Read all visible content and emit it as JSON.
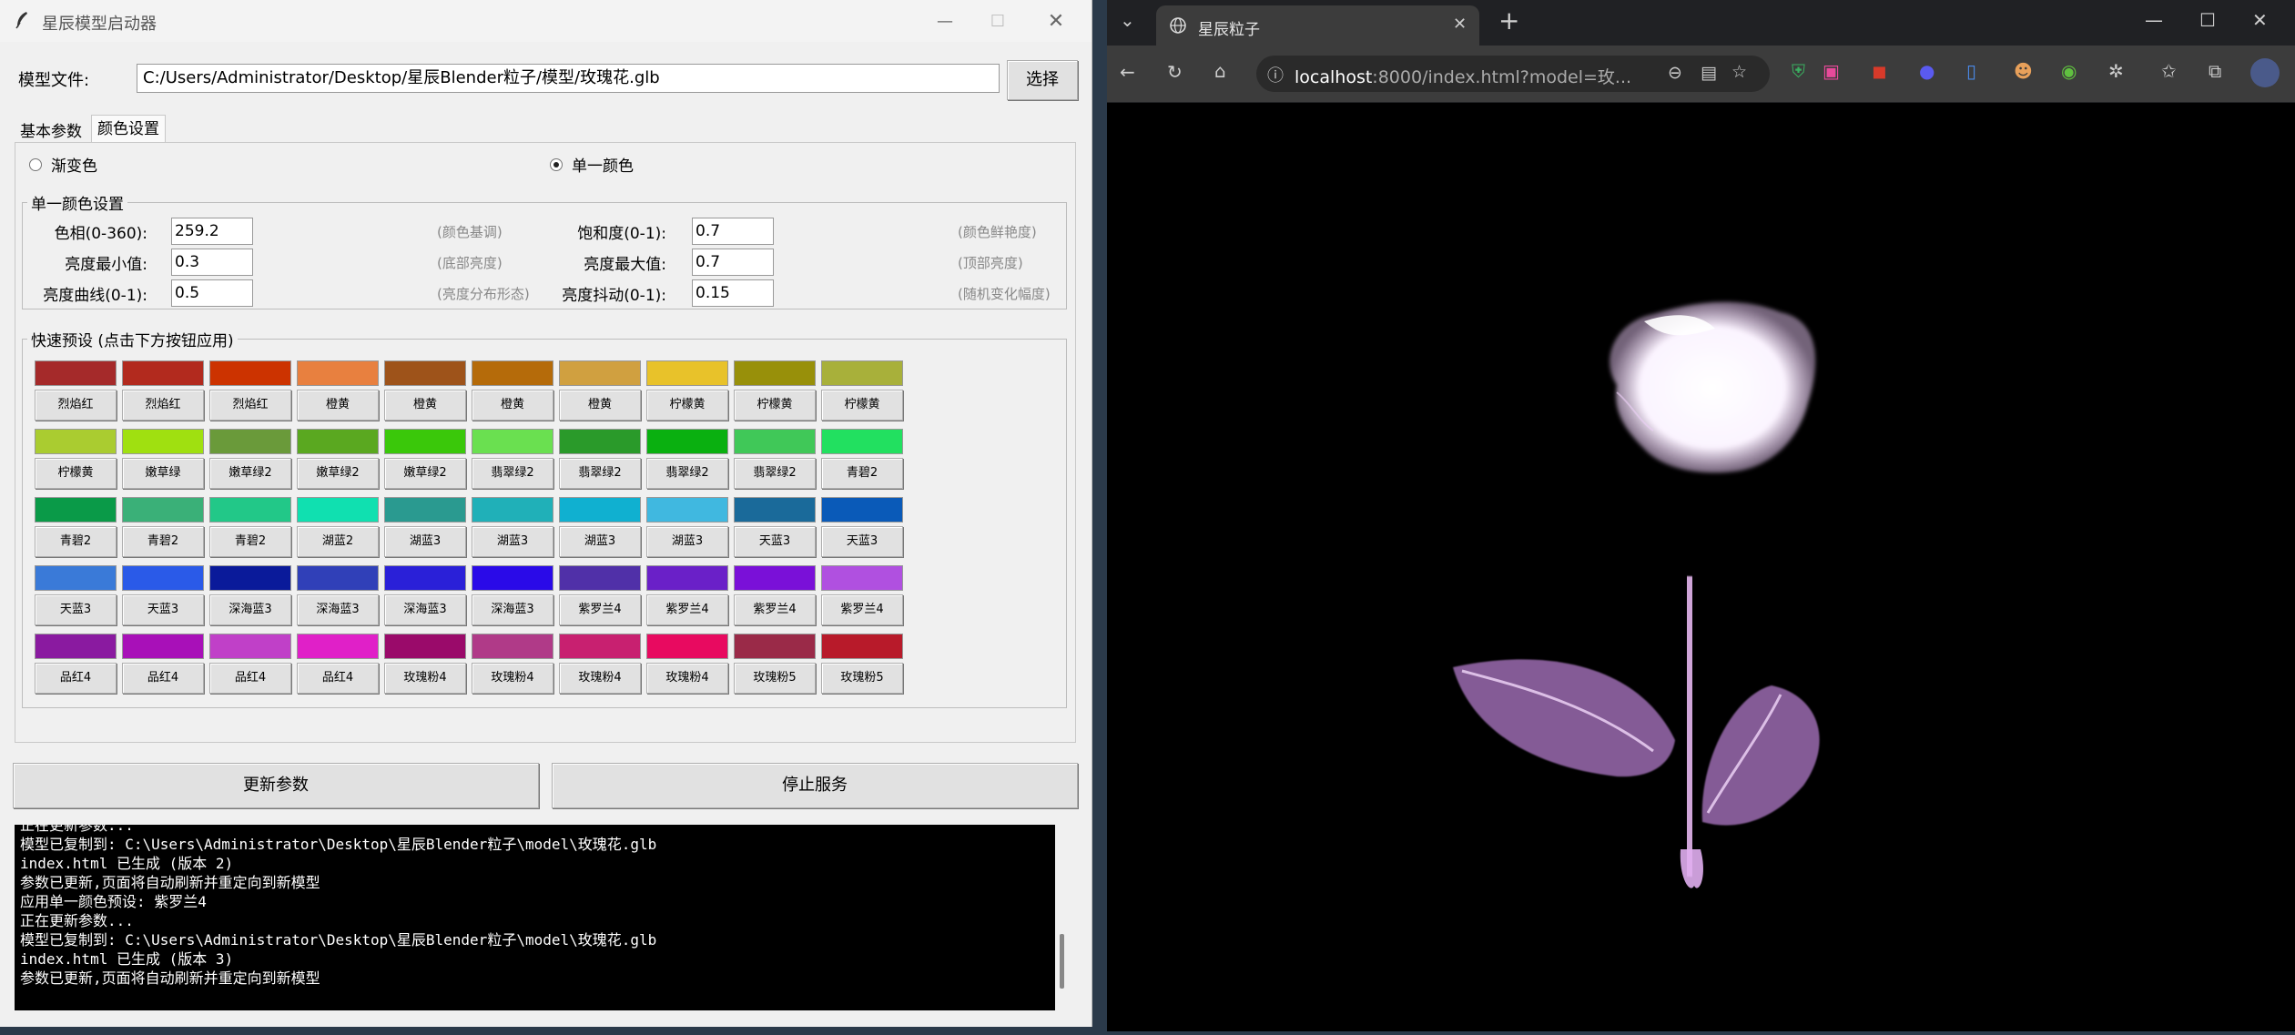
{
  "launcher": {
    "title": "星辰模型启动器",
    "model_file_label": "模型文件:",
    "model_file_value": "C:/Users/Administrator/Desktop/星辰Blender粒子/模型/玫瑰花.glb",
    "select_button": "选择",
    "tabs": [
      {
        "label": "基本参数",
        "active": false
      },
      {
        "label": "颜色设置",
        "active": true
      }
    ],
    "mode_options": [
      {
        "label": "渐变色",
        "selected": false
      },
      {
        "label": "单一颜色",
        "selected": true
      }
    ],
    "single_color": {
      "title": "单一颜色设置",
      "params": [
        {
          "label": "色相(0-360):",
          "value": "259.2",
          "hint": "(颜色基调)"
        },
        {
          "label": "饱和度(0-1):",
          "value": "0.7",
          "hint": "(颜色鲜艳度)"
        },
        {
          "label": "亮度最小值:",
          "value": "0.3",
          "hint": "(底部亮度)"
        },
        {
          "label": "亮度最大值:",
          "value": "0.7",
          "hint": "(顶部亮度)"
        },
        {
          "label": "亮度曲线(0-1):",
          "value": "0.5",
          "hint": "(亮度分布形态)"
        },
        {
          "label": "亮度抖动(0-1):",
          "value": "0.15",
          "hint": "(随机变化幅度)"
        }
      ]
    },
    "presets": {
      "title": "快速预设 (点击下方按钮应用)",
      "rows": [
        [
          {
            "name": "烈焰红",
            "color": "#a52a2a"
          },
          {
            "name": "烈焰红",
            "color": "#b22a1e"
          },
          {
            "name": "烈焰红",
            "color": "#cc3300"
          },
          {
            "name": "橙黄",
            "color": "#e8803f"
          },
          {
            "name": "橙黄",
            "color": "#9e531a"
          },
          {
            "name": "橙黄",
            "color": "#b56b0a"
          },
          {
            "name": "橙黄",
            "color": "#d0a040"
          },
          {
            "name": "柠檬黄",
            "color": "#e8c22a"
          },
          {
            "name": "柠檬黄",
            "color": "#98900a"
          },
          {
            "name": "柠檬黄",
            "color": "#a8b03a"
          }
        ],
        [
          {
            "name": "柠檬黄",
            "color": "#aacc30"
          },
          {
            "name": "嫩草绿",
            "color": "#a0e010"
          },
          {
            "name": "嫩草绿2",
            "color": "#6a9a3a"
          },
          {
            "name": "嫩草绿2",
            "color": "#5aa820"
          },
          {
            "name": "嫩草绿2",
            "color": "#3ac80a"
          },
          {
            "name": "翡翠绿2",
            "color": "#6ae050"
          },
          {
            "name": "翡翠绿2",
            "color": "#2a9a2a"
          },
          {
            "name": "翡翠绿2",
            "color": "#0ab010"
          },
          {
            "name": "翡翠绿2",
            "color": "#40c858"
          },
          {
            "name": "青碧2",
            "color": "#22e060"
          }
        ],
        [
          {
            "name": "青碧2",
            "color": "#0a9a48"
          },
          {
            "name": "青碧2",
            "color": "#3ab078"
          },
          {
            "name": "青碧2",
            "color": "#22c888"
          },
          {
            "name": "湖蓝2",
            "color": "#10e0b0"
          },
          {
            "name": "湖蓝3",
            "color": "#2a9a90"
          },
          {
            "name": "湖蓝3",
            "color": "#20b0b8"
          },
          {
            "name": "湖蓝3",
            "color": "#10b0d0"
          },
          {
            "name": "湖蓝3",
            "color": "#40b8e0"
          },
          {
            "name": "天蓝3",
            "color": "#1a6a9a"
          },
          {
            "name": "天蓝3",
            "color": "#0a5ab8"
          }
        ],
        [
          {
            "name": "天蓝3",
            "color": "#3a7ad8"
          },
          {
            "name": "天蓝3",
            "color": "#2a5ae8"
          },
          {
            "name": "深海蓝3",
            "color": "#0a1a9a"
          },
          {
            "name": "深海蓝3",
            "color": "#3040b8"
          },
          {
            "name": "深海蓝3",
            "color": "#2a20d8"
          },
          {
            "name": "深海蓝3",
            "color": "#2a0ae8"
          },
          {
            "name": "紫罗兰4",
            "color": "#5030a8"
          },
          {
            "name": "紫罗兰4",
            "color": "#6a20c8"
          },
          {
            "name": "紫罗兰4",
            "color": "#7a10d8"
          },
          {
            "name": "紫罗兰4",
            "color": "#b050e0"
          }
        ],
        [
          {
            "name": "品红4",
            "color": "#8a1aa0"
          },
          {
            "name": "品红4",
            "color": "#a810b8"
          },
          {
            "name": "品红4",
            "color": "#c040c8"
          },
          {
            "name": "品红4",
            "color": "#e020c8"
          },
          {
            "name": "玫瑰粉4",
            "color": "#9a0a6a"
          },
          {
            "name": "玫瑰粉4",
            "color": "#b03a88"
          },
          {
            "name": "玫瑰粉4",
            "color": "#c82070"
          },
          {
            "name": "玫瑰粉4",
            "color": "#e80a60"
          },
          {
            "name": "玫瑰粉5",
            "color": "#9a2a48"
          },
          {
            "name": "玫瑰粉5",
            "color": "#b81a2a"
          }
        ]
      ]
    },
    "update_button": "更新参数",
    "stop_button": "停止服务",
    "console_lines": [
      "正在更新参数...",
      "模型已复制到: C:\\Users\\Administrator\\Desktop\\星辰Blender粒子\\model\\玫瑰花.glb",
      "index.html 已生成 (版本 2)",
      "参数已更新,页面将自动刷新并重定向到新模型",
      "应用单一颜色预设: 紫罗兰4",
      "正在更新参数...",
      "模型已复制到: C:\\Users\\Administrator\\Desktop\\星辰Blender粒子\\model\\玫瑰花.glb",
      "index.html 已生成 (版本 3)",
      "参数已更新,页面将自动刷新并重定向到新模型"
    ]
  },
  "browser": {
    "tab_title": "星辰粒子",
    "url_host": "localhost",
    "url_rest": ":8000/index.html?model=玫..."
  }
}
